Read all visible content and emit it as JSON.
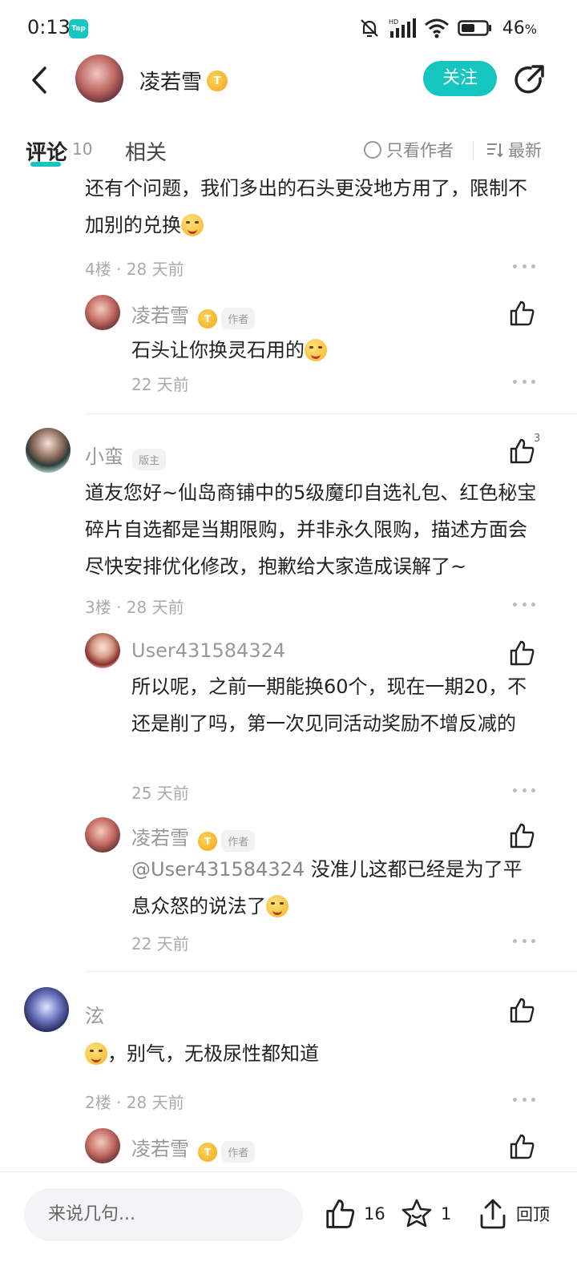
{
  "status_bar": {
    "time": "0:13",
    "app_badge": "Tap",
    "battery_percent": "46",
    "battery_unit": "%"
  },
  "header": {
    "author_name": "凌若雪",
    "badge_letter": "T",
    "follow_label": "关注"
  },
  "tabs": {
    "comments_label": "评论",
    "comments_count": "10",
    "related_label": "相关",
    "author_only_label": "只看作者",
    "sort_label": "最新"
  },
  "comments": {
    "c4": {
      "text": "还有个问题，我们多出的石头更没地方用了，限制不加别的兑换",
      "meta": "4楼 · 28 天前",
      "reply1": {
        "name": "凌若雪",
        "tag": "作者",
        "text": "石头让你换灵石用的",
        "time": "22 天前"
      }
    },
    "c3": {
      "name": "小蛮",
      "tag": "版主",
      "like_count": "3",
      "text": "道友您好~仙岛商铺中的5级魔印自选礼包、红色秘宝碎片自选都是当期限购，并非永久限购，描述方面会尽快安排优化修改，抱歉给大家造成误解了~",
      "meta": "3楼 · 28 天前",
      "reply1": {
        "name": "User431584324",
        "text": "所以呢，之前一期能换60个，现在一期20，不还是削了吗，第一次见同活动奖励不增反减的",
        "time": "25 天前"
      },
      "reply2": {
        "name": "凌若雪",
        "tag": "作者",
        "mention": "@User431584324",
        "text": "没准儿这都已经是为了平息众怒的说法了",
        "time": "22 天前"
      }
    },
    "c2": {
      "name": "泫",
      "text": "，别气，无极尿性都知道",
      "meta": "2楼 · 28 天前",
      "reply1": {
        "name": "凌若雪",
        "tag": "作者"
      }
    }
  },
  "bottom_bar": {
    "input_placeholder": "来说几句...",
    "like_count": "16",
    "star_count": "1",
    "back_top_label": "回顶"
  },
  "colors": {
    "accent": "#15c5c0",
    "badge_gold": "#f0a418"
  },
  "icons": [
    "back-icon",
    "share-icon",
    "radio-icon",
    "sort-icon",
    "more-icon",
    "thumbs-up-icon",
    "star-icon",
    "upload-top-icon"
  ]
}
